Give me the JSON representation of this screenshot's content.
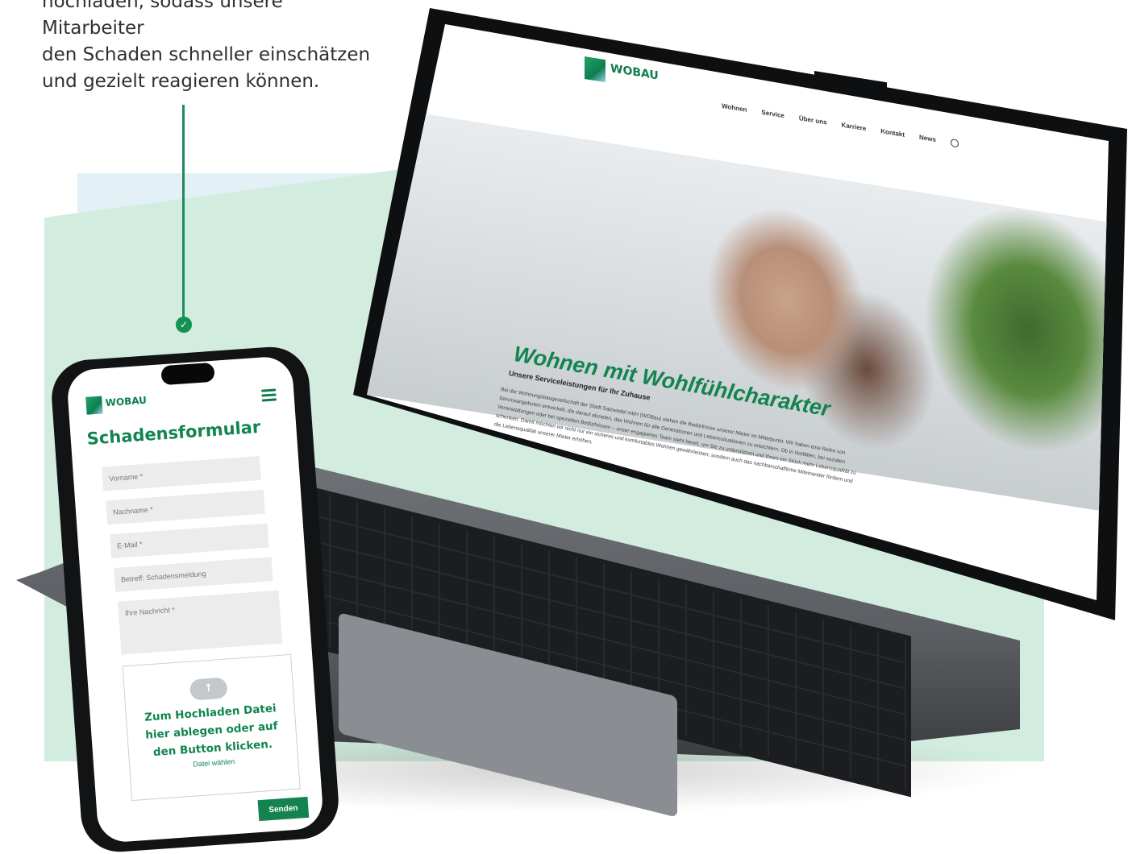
{
  "intro": {
    "lines": [
      "hochladen, sodass unsere Mitarbeiter",
      "den Schaden schneller einschätzen",
      "und gezielt reagieren können."
    ]
  },
  "colors": {
    "brand_green": "#11844f",
    "mint_bg": "#d3ece0",
    "light_blue_bg": "#e3f1f6"
  },
  "laptop": {
    "logo": "WOBAU",
    "nav": [
      "Wohnen",
      "Service",
      "Über uns",
      "Karriere",
      "Kontakt",
      "News"
    ],
    "heading": "Wohnen mit Wohlfühlcharakter",
    "subheading": "Unsere Serviceleistungen für Ihr Zuhause",
    "paragraph": "Bei der Wohnungsbaugesellschaft der Stadt Salzwedel mbH (WOBau) stehen die Bedürfnisse unserer Mieter im Mittelpunkt. Wir haben eine Reihe von Serviceangeboten entwickelt, die darauf abzielen, das Wohnen für alle Generationen und Lebenssituationen zu erleichtern. Ob in Notfällen, bei sozialen Veranstaltungen oder bei speziellen Bedürfnissen – unser engagiertes Team steht bereit, um Sie zu unterstützen und Ihnen ein Stück mehr Lebensqualität zu schenken. Damit möchten wir nicht nur ein sicheres und komfortables Wohnen gewährleisten, sondern auch das nachbarschaftliche Miteinander fördern und die Lebensqualität unserer Mieter erhöhen."
  },
  "phone": {
    "logo": "WOBAU",
    "title": "Schadensformular",
    "fields": {
      "vorname": "Vorname *",
      "nachname": "Nachname *",
      "email": "E-Mail *",
      "betreff": "Betreff: Schadensmeldung",
      "nachricht": "Ihre Nachricht *"
    },
    "upload_text": "Zum Hochladen Datei hier ablegen oder auf den Button klicken.",
    "upload_link": "Datei wählen",
    "send_button": "Senden"
  }
}
